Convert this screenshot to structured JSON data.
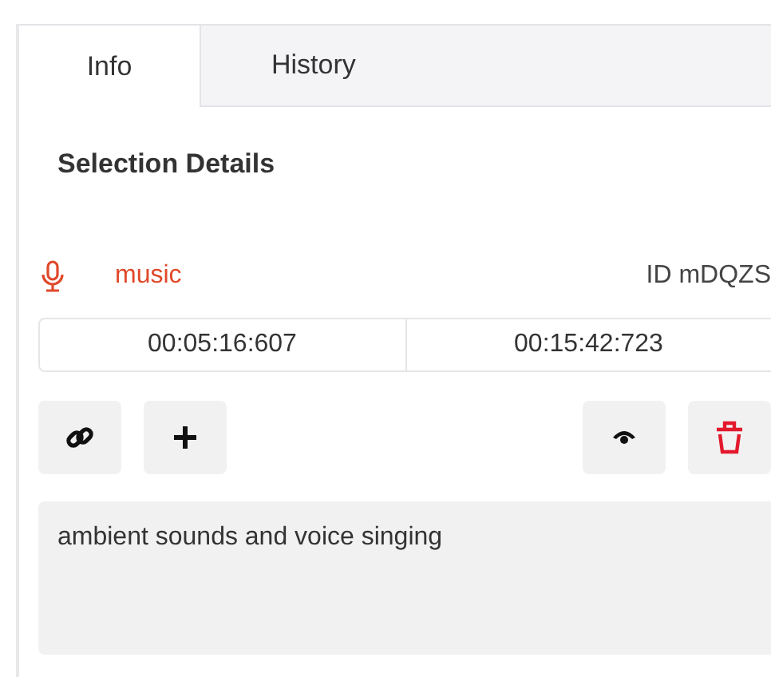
{
  "tabs": [
    {
      "label": "Info",
      "selected": true
    },
    {
      "label": "History",
      "selected": false
    }
  ],
  "heading": "Selection Details",
  "region": {
    "label": "music",
    "id": "ID mDQZS"
  },
  "times": {
    "start": "00:05:16:607",
    "end": "00:15:42:723"
  },
  "notes": {
    "value": "ambient sounds and voice singing"
  }
}
